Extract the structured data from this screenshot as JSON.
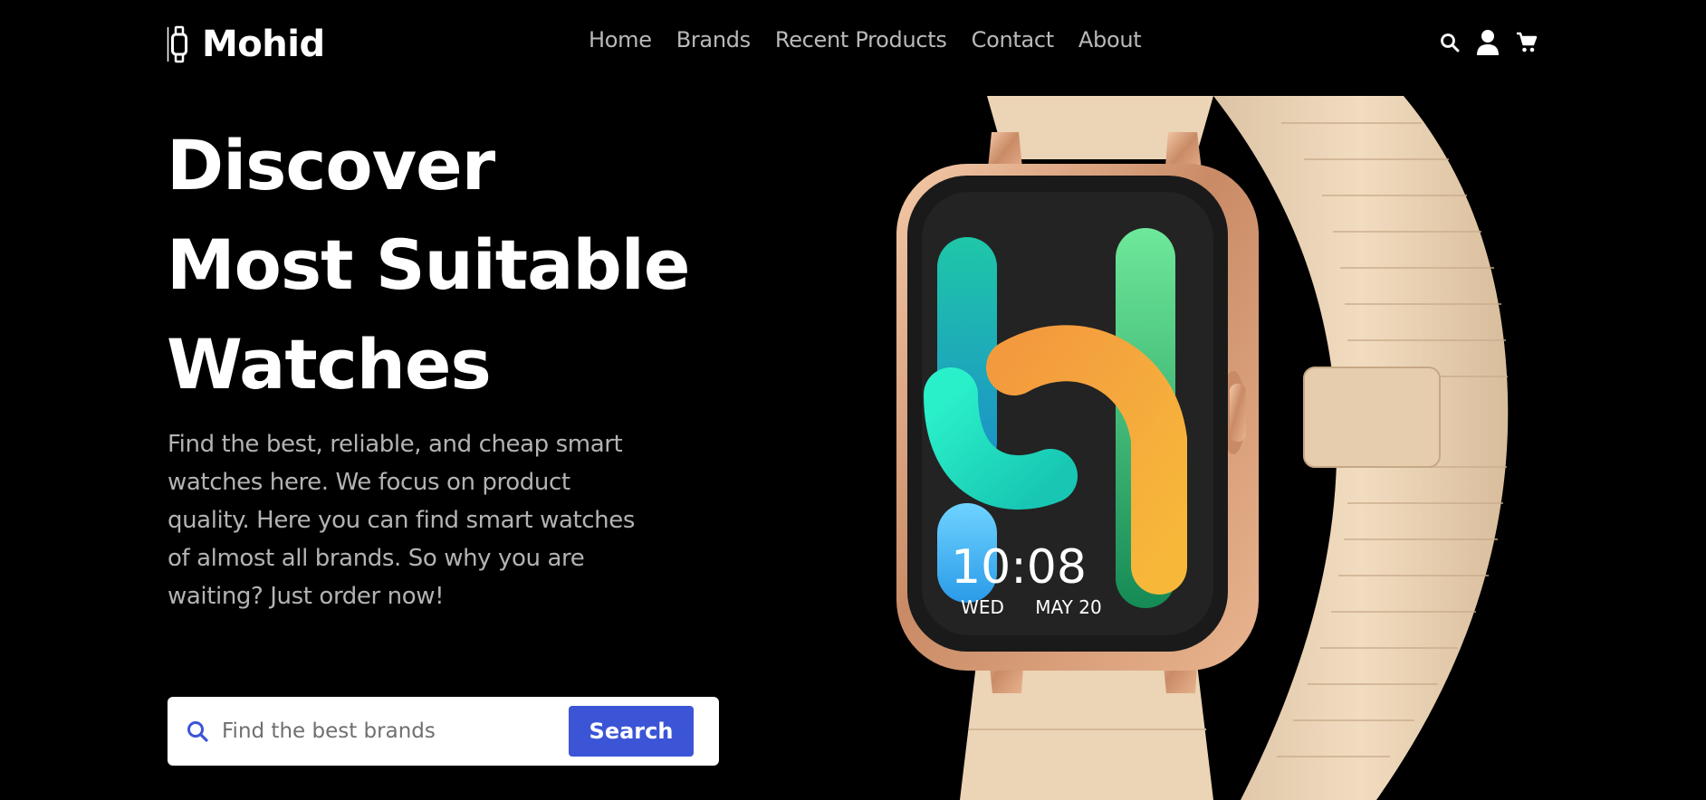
{
  "brand": {
    "name": "Mohid",
    "icon": "watch-icon"
  },
  "nav": {
    "items": [
      {
        "label": "Home"
      },
      {
        "label": "Brands"
      },
      {
        "label": "Recent Products"
      },
      {
        "label": "Contact"
      },
      {
        "label": "About"
      }
    ]
  },
  "header_icons": [
    "search-icon",
    "user-icon",
    "cart-icon"
  ],
  "hero": {
    "title_lines": [
      "Discover",
      "Most Suitable",
      "Watches"
    ],
    "description": "Find the best, reliable, and cheap smart watches here. We focus on product quality. Here you can find smart watches of almost all brands. So why you are waiting? Just order now!"
  },
  "search": {
    "placeholder": "Find the best brands",
    "value": "",
    "button_label": "Search"
  },
  "watch_face": {
    "time": "10:08",
    "day": "WED",
    "date": "MAY 20"
  },
  "colors": {
    "background": "#000000",
    "accent": "#3b55d6",
    "nav_text": "#b9b9b9",
    "description_text": "#b3b3b3"
  }
}
